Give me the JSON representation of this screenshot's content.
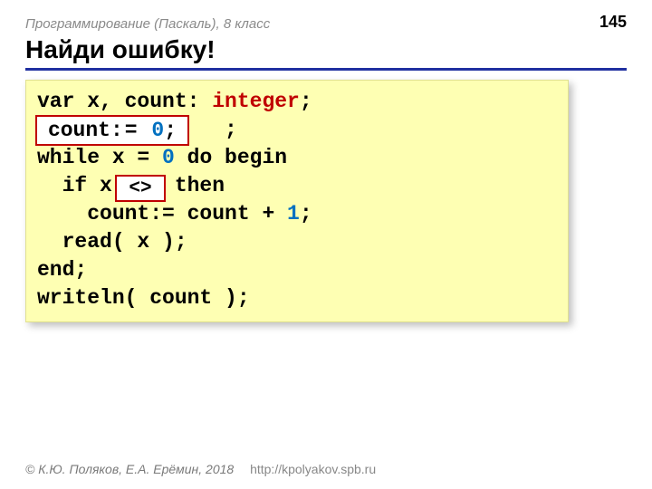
{
  "header": {
    "course": "Программирование (Паскаль), 8 класс",
    "page": "145"
  },
  "title": "Найди ошибку!",
  "code": {
    "l1a": "var x, count: ",
    "l1b": "integer",
    "l1c": ";",
    "l2_hidden_sp": "               ",
    "l2_hidden_rest": ";",
    "l3a": "while x = ",
    "l3b": "0",
    "l3c": " do begin",
    "l4": "  if x >   then",
    "l5a": "    count:= count + ",
    "l5b": "1",
    "l5c": ";",
    "l6": "  read( x );",
    "l7": "end;",
    "l8": "writeln( count );"
  },
  "patches": {
    "p1_left": "count:",
    "p1_eq": "=",
    "p1_sp": " ",
    "p1_zero": "0",
    "p1_right": ";",
    "p2": "<>"
  },
  "footer": {
    "copyright": "© К.Ю. Поляков, Е.А. Ерёмин, 2018",
    "url": "http://kpolyakov.spb.ru"
  }
}
